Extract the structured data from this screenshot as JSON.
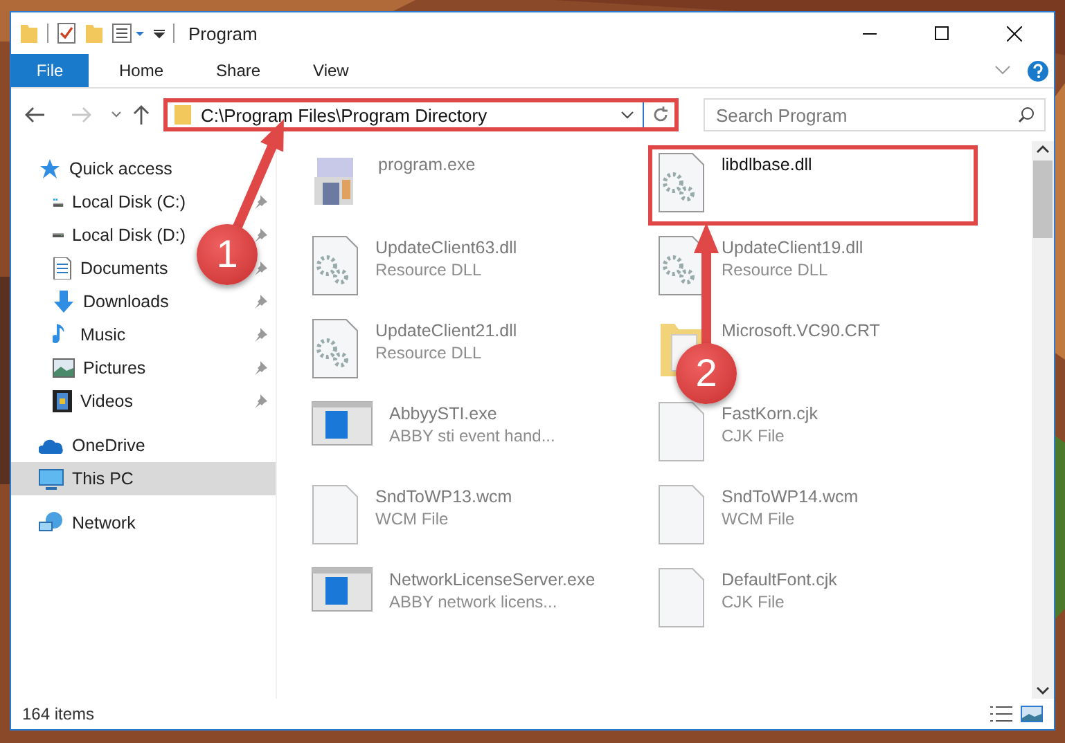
{
  "window": {
    "title": "Program"
  },
  "ribbon": {
    "file_button": "File",
    "tabs": [
      "Home",
      "Share",
      "View"
    ]
  },
  "address": {
    "path": "C:\\Program Files\\Program Directory",
    "highlighted": true
  },
  "search": {
    "placeholder": "Search Program"
  },
  "sidebar": {
    "items": [
      {
        "label": "Quick access",
        "kind": "quick-access",
        "selected": false,
        "children": [
          {
            "label": "Local Disk (C:)",
            "kind": "system-drive",
            "pinned": true
          },
          {
            "label": "Local Disk (D:)",
            "kind": "drive",
            "pinned": true
          },
          {
            "label": "Documents",
            "kind": "documents",
            "pinned": true
          },
          {
            "label": "Downloads",
            "kind": "downloads",
            "pinned": true
          },
          {
            "label": "Music",
            "kind": "music",
            "pinned": true
          },
          {
            "label": "Pictures",
            "kind": "pictures",
            "pinned": true
          },
          {
            "label": "Videos",
            "kind": "videos",
            "pinned": true
          }
        ]
      },
      {
        "label": "OneDrive",
        "kind": "cloud",
        "selected": false
      },
      {
        "label": "This PC",
        "kind": "computer",
        "selected": true
      },
      {
        "label": "Network",
        "kind": "network",
        "selected": false
      }
    ]
  },
  "files": [
    {
      "name": "program.exe",
      "kind": "installer",
      "blurred": true,
      "highlighted": false
    },
    {
      "name": "libdlbase.dll",
      "kind": "dll",
      "blurred": false,
      "highlighted": true
    },
    {
      "name": "UpdateClient63.dll",
      "subtitle": "Resource DLL",
      "kind": "dll",
      "blurred": true,
      "highlighted": false
    },
    {
      "name": "UpdateClient19.dll",
      "subtitle": "Resource DLL",
      "kind": "dll",
      "blurred": true,
      "highlighted": false
    },
    {
      "name": "UpdateClient21.dll",
      "subtitle": "Resource DLL",
      "kind": "dll",
      "blurred": true,
      "highlighted": false
    },
    {
      "name": "Microsoft.VC90.CRT",
      "kind": "folder",
      "blurred": true,
      "highlighted": false
    },
    {
      "name": "AbbyySTI.exe",
      "subtitle": "ABBY sti event hand...",
      "kind": "app",
      "blurred": true,
      "highlighted": false
    },
    {
      "name": "FastKorn.cjk",
      "subtitle": "CJK File",
      "kind": "blank",
      "blurred": true,
      "highlighted": false
    },
    {
      "name": "SndToWP13.wcm",
      "subtitle": "WCM File",
      "kind": "blank",
      "blurred": true,
      "highlighted": false
    },
    {
      "name": "SndToWP14.wcm",
      "subtitle": "WCM File",
      "kind": "blank",
      "blurred": true,
      "highlighted": false
    },
    {
      "name": "NetworkLicenseServer.exe",
      "subtitle": "ABBY network licens...",
      "kind": "app",
      "blurred": true,
      "highlighted": false
    },
    {
      "name": "DefaultFont.cjk",
      "subtitle": "CJK File",
      "kind": "blank",
      "blurred": true,
      "highlighted": false
    }
  ],
  "status_bar": {
    "count": "164 items"
  },
  "annotations": [
    {
      "number": "1"
    },
    {
      "number": "2"
    }
  ]
}
